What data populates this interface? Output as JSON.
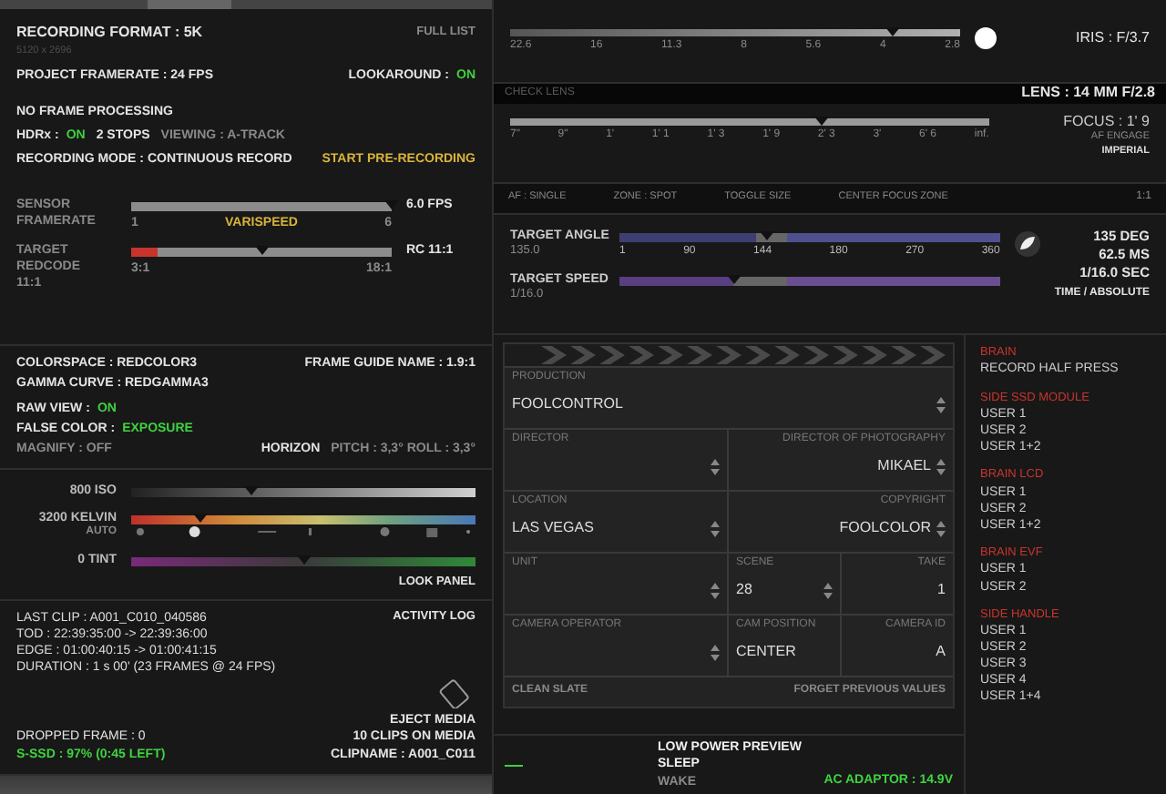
{
  "recording": {
    "format": "RECORDING FORMAT : 5K",
    "resolution": "5120 x 2696",
    "full_list": "FULL LIST",
    "project_framerate": "PROJECT FRAMERATE : 24 FPS",
    "lookaround_label": "LOOKAROUND :",
    "lookaround_value": "ON",
    "frame_processing": "NO FRAME PROCESSING",
    "hdrx_label": "HDRx :",
    "hdrx_value": "ON",
    "stops": "2 STOPS",
    "viewing": "VIEWING : A-TRACK",
    "mode": "RECORDING MODE : CONTINUOUS RECORD",
    "pre_record": "START PRE-RECORDING"
  },
  "sensor_framerate": {
    "label": "SENSOR FRAMERATE",
    "level": 1,
    "min": "1",
    "center": "VARISPEED",
    "max": "6",
    "reading": "6.0 FPS"
  },
  "target_redcode": {
    "label": "TARGET REDCODE",
    "value": "11:1",
    "level": 0.5,
    "min": "3:1",
    "max": "18:1",
    "reading": "RC 11:1"
  },
  "color": {
    "colorspace": "COLORSPACE : REDCOLOR3",
    "gamma": "GAMMA CURVE  : REDGAMMA3",
    "frame_guide": "FRAME GUIDE NAME : 1.9:1",
    "raw_view_label": "RAW VIEW :",
    "raw_view_value": "ON",
    "false_color_label": "FALSE COLOR :",
    "false_color_value": "EXPOSURE",
    "magnify": "MAGNIFY : OFF",
    "horizon_label": "HORIZON",
    "horizon_value": "PITCH : 3,3° ROLL : 3,3°"
  },
  "look": {
    "sliders": [
      {
        "kind": "iso",
        "label": "800 ISO",
        "level": 0.35
      },
      {
        "kind": "kelvin",
        "label": "3200 KELVIN",
        "sub": "AUTO",
        "level": 0.2
      },
      {
        "kind": "tint",
        "label": "0 TINT",
        "level": 0.5
      }
    ],
    "panel": "LOOK PANEL"
  },
  "clip": {
    "activity_log": "ACTIVITY LOG",
    "lines": [
      "LAST CLIP : A001_C010_040586",
      "TOD : 22:39:35:00 -> 22:39:36:00",
      "EDGE : 01:00:40:15 -> 01:00:41:15",
      "DURATION : 1 s 00' (23 FRAMES @ 24 FPS)"
    ],
    "eject": "EJECT MEDIA",
    "dropped": "DROPPED FRAME : 0",
    "clips": "10 CLIPS ON MEDIA",
    "ssd": "S-SSD : 97% (0:45 LEFT)",
    "clipname": "CLIPNAME : A001_C011"
  },
  "iris": {
    "ticks": [
      "22.6",
      "16",
      "11.3",
      "8",
      "5.6",
      "4",
      "2.8"
    ],
    "level": 0.85,
    "reading": "IRIS : F/3.7"
  },
  "lens": {
    "check_lens": "CHECK LENS",
    "name": "LENS : 14 MM F/2.8"
  },
  "focus": {
    "ticks": [
      "7\"",
      "9\"",
      "1'",
      "1' 1",
      "1' 3",
      "1' 9",
      "2' 3",
      "3'",
      "6' 6",
      "inf."
    ],
    "level": 0.65,
    "reading": "FOCUS : 1' 9",
    "af_engage": "AF ENGAGE",
    "units": "IMPERIAL"
  },
  "af": {
    "items": [
      "AF : SINGLE",
      "ZONE : SPOT",
      "TOGGLE SIZE",
      "CENTER FOCUS ZONE"
    ],
    "ratio": "1:1"
  },
  "shutter": {
    "angle": {
      "label": "TARGET ANGLE",
      "value": "135.0",
      "level": 0.39,
      "ticks": [
        "1",
        "90",
        "144",
        "180",
        "270",
        "360"
      ]
    },
    "speed": {
      "label": "TARGET SPEED",
      "value": "1/16.0",
      "level": 0.3
    },
    "readings": [
      "135 DEG",
      "62.5 MS",
      "1/16.0 SEC"
    ],
    "mode": "TIME / ABSOLUTE"
  },
  "slate": {
    "rows": [
      [
        {
          "label": "PRODUCTION",
          "value": "FOOLCONTROL",
          "spinner": true
        }
      ],
      [
        {
          "label": "DIRECTOR",
          "spinner": true
        },
        {
          "label": "DIRECTOR OF PHOTOGRAPHY",
          "value": "MIKAEL",
          "spinner": true
        }
      ],
      [
        {
          "label": "LOCATION",
          "value": "LAS VEGAS",
          "spinner": true
        },
        {
          "label": "COPYRIGHT",
          "value": "FOOLCOLOR",
          "spinner": true
        }
      ],
      [
        {
          "label": "UNIT",
          "spinner": true
        },
        {
          "label": "SCENE",
          "value": "28",
          "spinner": true
        },
        {
          "label": "TAKE",
          "value": "1",
          "spinner": false
        }
      ],
      [
        {
          "label": "CAMERA OPERATOR",
          "spinner": true
        },
        {
          "label": "CAM POSITION",
          "value": "CENTER",
          "spinner": false
        },
        {
          "label": "CAMERA ID",
          "value": "A",
          "spinner": false
        }
      ]
    ],
    "clean": "CLEAN SLATE",
    "forget": "FORGET PREVIOUS VALUES"
  },
  "power": {
    "items": [
      {
        "label": "LOW POWER PREVIEW",
        "active": true
      },
      {
        "label": "SLEEP",
        "active": true
      },
      {
        "label": "WAKE",
        "active": false
      }
    ],
    "adaptor": "AC ADAPTOR : 14.9V"
  },
  "button_map": [
    {
      "name": "BRAIN",
      "items": [
        "RECORD HALF PRESS"
      ]
    },
    {
      "name": "SIDE SSD MODULE",
      "items": [
        "USER 1",
        "USER 2",
        "USER 1+2"
      ]
    },
    {
      "name": "BRAIN LCD",
      "items": [
        "USER 1",
        "USER 2",
        "USER 1+2"
      ]
    },
    {
      "name": "BRAIN EVF",
      "items": [
        "USER 1",
        "USER 2"
      ]
    },
    {
      "name": "SIDE HANDLE",
      "items": [
        "USER 1",
        "USER 2",
        "USER 3",
        "USER 4",
        "USER 1+4"
      ]
    }
  ]
}
